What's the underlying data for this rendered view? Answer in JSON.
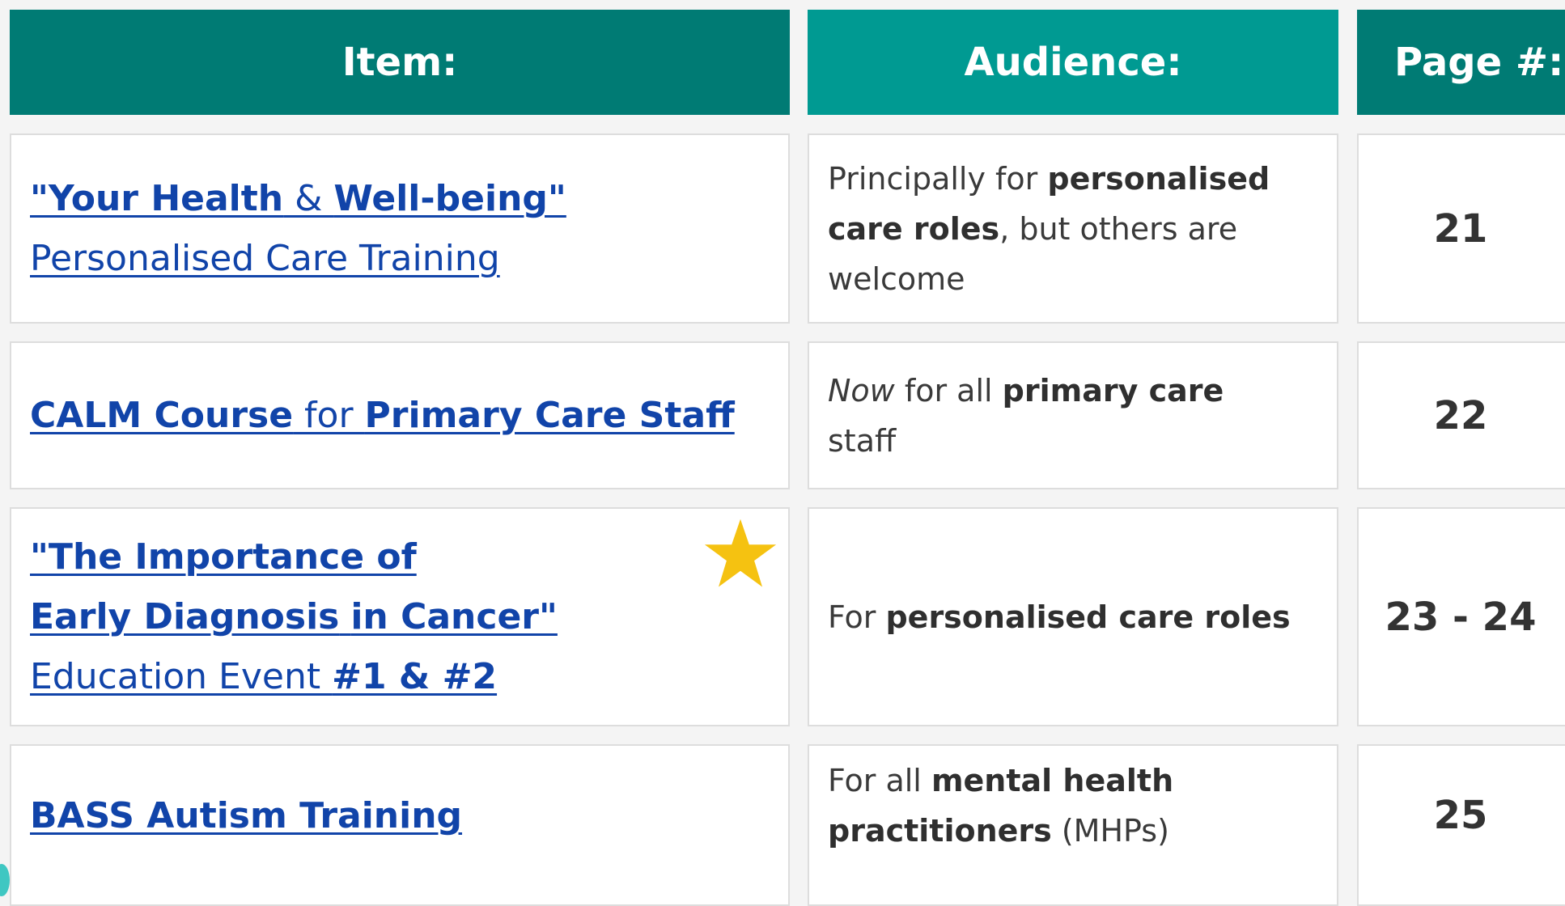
{
  "headers": {
    "item": "Item:",
    "audience": "Audience:",
    "page": "Page #:"
  },
  "rows": [
    {
      "item": {
        "line1_part1": "\"Your Health",
        "line1_amp": " & ",
        "line1_part2": "Well-being\"",
        "line2": "Personalised Care Training"
      },
      "audience": {
        "t1": "Principally for ",
        "b1": "personalised",
        "b2": "care roles",
        "t2": ", but others are",
        "t3": "welcome"
      },
      "page": "21"
    },
    {
      "item": {
        "part1": "CALM Course",
        "part2": " for ",
        "part3": "Primary Care Staff"
      },
      "audience": {
        "i1": "Now",
        "t1": " for all ",
        "b1": "primary care",
        "t2": "staff"
      },
      "page": "22"
    },
    {
      "item": {
        "line1": "\"The Importance of ",
        "line2_part1": "Early Diagnosis",
        "line2_part2": "in Cancer\"",
        "line3_plain": "Education Event ",
        "line3_bold": "#1 & #2"
      },
      "audience": {
        "t1": "For ",
        "b1": "personalised care roles"
      },
      "page": "23 - 24",
      "starred": true
    },
    {
      "item": {
        "line1": "BASS Autism Training"
      },
      "audience": {
        "t1": "For all ",
        "b1": "mental health",
        "b2": "practitioners",
        "t2": " (MHPs)"
      },
      "page": "25"
    }
  ],
  "colors": {
    "header_dark": "#007b74",
    "header_light": "#009a92",
    "link": "#1144a9",
    "star": "#f5c211"
  },
  "icons": {
    "star": "star-icon"
  }
}
